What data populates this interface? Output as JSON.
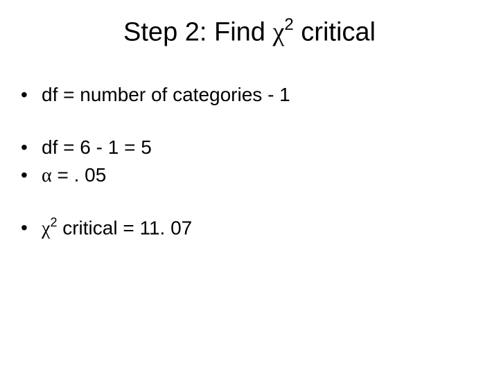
{
  "title": {
    "prefix": "Step 2: Find ",
    "chi": "χ",
    "sup": "2",
    "suffix": " critical"
  },
  "bullets": {
    "b1": "df = number of categories - 1",
    "b2": "df = 6 - 1 = 5",
    "b3_alpha": "α",
    "b3_rest": " = . 05",
    "b4_chi": "χ",
    "b4_sup": "2",
    "b4_rest": " critical = 11. 07"
  },
  "dot": "•"
}
